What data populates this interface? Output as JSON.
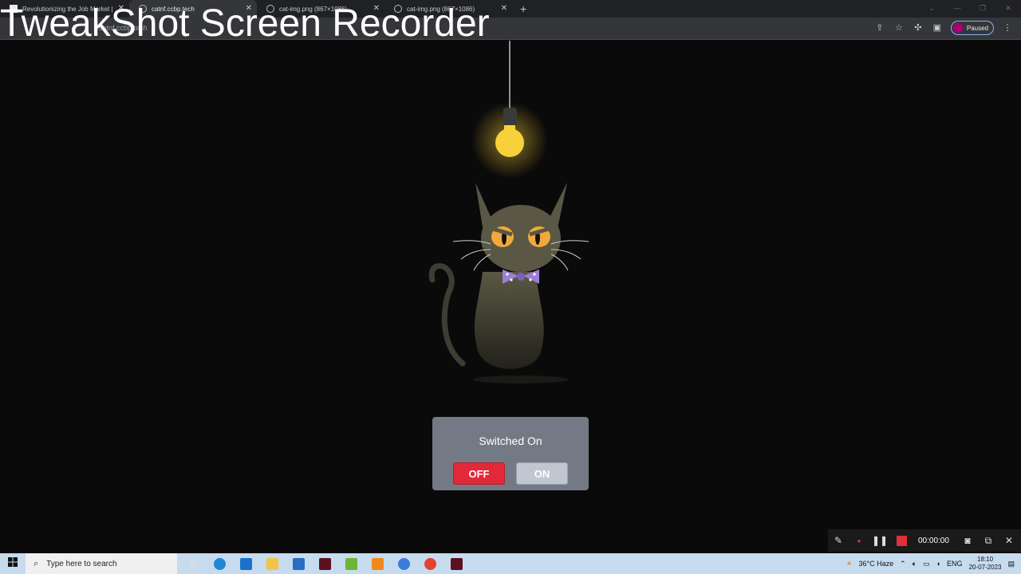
{
  "browser": {
    "tabs": [
      {
        "label": "Revolutionizing the Job Market |",
        "active": false
      },
      {
        "label": "catnf.ccbp.tech",
        "active": true
      },
      {
        "label": "cat-img.png (867×1086)",
        "active": false
      },
      {
        "label": "cat-img.png (867×1086)",
        "active": false
      }
    ],
    "url": "catnf.ccbp.tech",
    "profile_status": "Paused"
  },
  "watermark": "TweakShot Screen Recorder",
  "page": {
    "status_text": "Switched On",
    "off_label": "OFF",
    "on_label": "ON",
    "colors": {
      "off": "#e2293a",
      "panel": "#737a86",
      "bulb": "#f7d13a"
    }
  },
  "recorder": {
    "timer": "00:00:00"
  },
  "taskbar": {
    "search_placeholder": "Type here to search",
    "weather": "36°C  Haze",
    "lang": "ENG",
    "time": "18:10",
    "date": "20-07-2023"
  }
}
